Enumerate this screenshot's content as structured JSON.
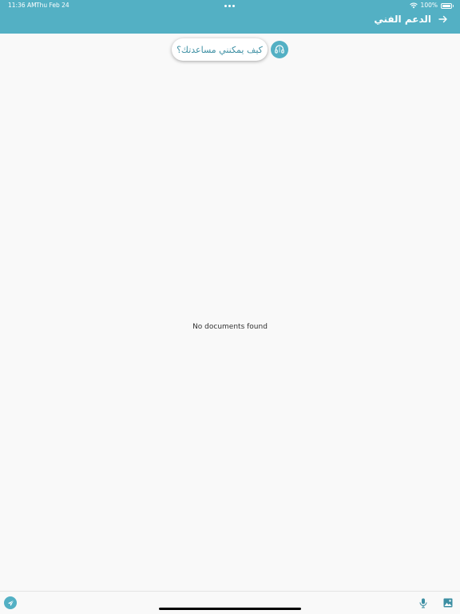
{
  "status_bar": {
    "time": "11:36 AM",
    "date": "Thu Feb 24",
    "battery": "100%"
  },
  "header": {
    "title": "الدعم الفني",
    "back_icon": "arrow-right-icon",
    "background": "#53b0c4"
  },
  "chat": {
    "greeting": "كيف يمكنني مساعدتك؟",
    "avatar_icon": "headset-icon"
  },
  "main": {
    "empty_message": "No documents found"
  },
  "toolbar": {
    "send_icon": "send-icon",
    "mic_icon": "microphone-icon",
    "image_icon": "image-icon",
    "accent": "#53b0c4"
  }
}
